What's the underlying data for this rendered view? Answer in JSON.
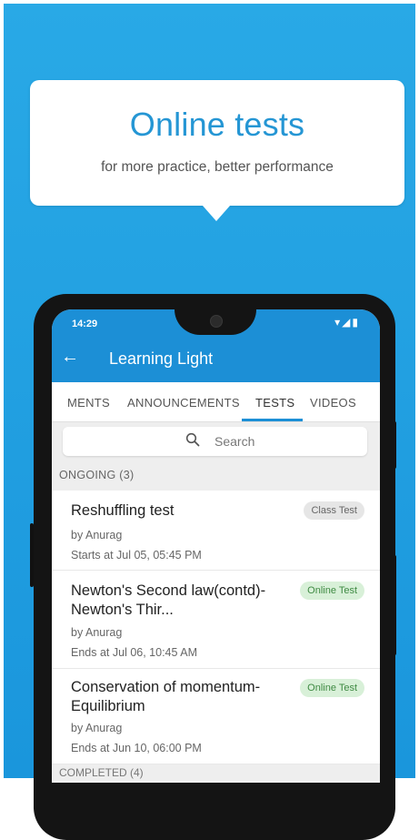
{
  "promo": {
    "headline": "Online tests",
    "subline": "for more practice, better performance"
  },
  "status": {
    "time": "14:29",
    "icons": "▾◢▮"
  },
  "appbar": {
    "back_icon": "←",
    "title": "Learning Light"
  },
  "tabs": [
    {
      "label": "MENTS"
    },
    {
      "label": "ANNOUNCEMENTS"
    },
    {
      "label": "TESTS"
    },
    {
      "label": "VIDEOS"
    }
  ],
  "search": {
    "placeholder": "Search"
  },
  "ongoing": {
    "label": "ONGOING (3)"
  },
  "tests": [
    {
      "title": "Reshuffling test",
      "by": "by Anurag",
      "date": "Starts at  Jul 05, 05:45 PM",
      "badge": "Class Test"
    },
    {
      "title": "Newton's Second law(contd)-Newton's Thir...",
      "by": "by Anurag",
      "date": "Ends at  Jul 06, 10:45 AM",
      "badge": "Online Test"
    },
    {
      "title": "Conservation of momentum-Equilibrium",
      "by": "by Anurag",
      "date": "Ends at  Jun 10, 06:00 PM",
      "badge": "Online Test"
    }
  ],
  "completed": {
    "label": "COMPLETED (4)"
  },
  "colors": {
    "primary": "#1c8fd6",
    "background": "#29a9e6",
    "online_badge": "#3f8a43",
    "class_badge": "#666666"
  }
}
